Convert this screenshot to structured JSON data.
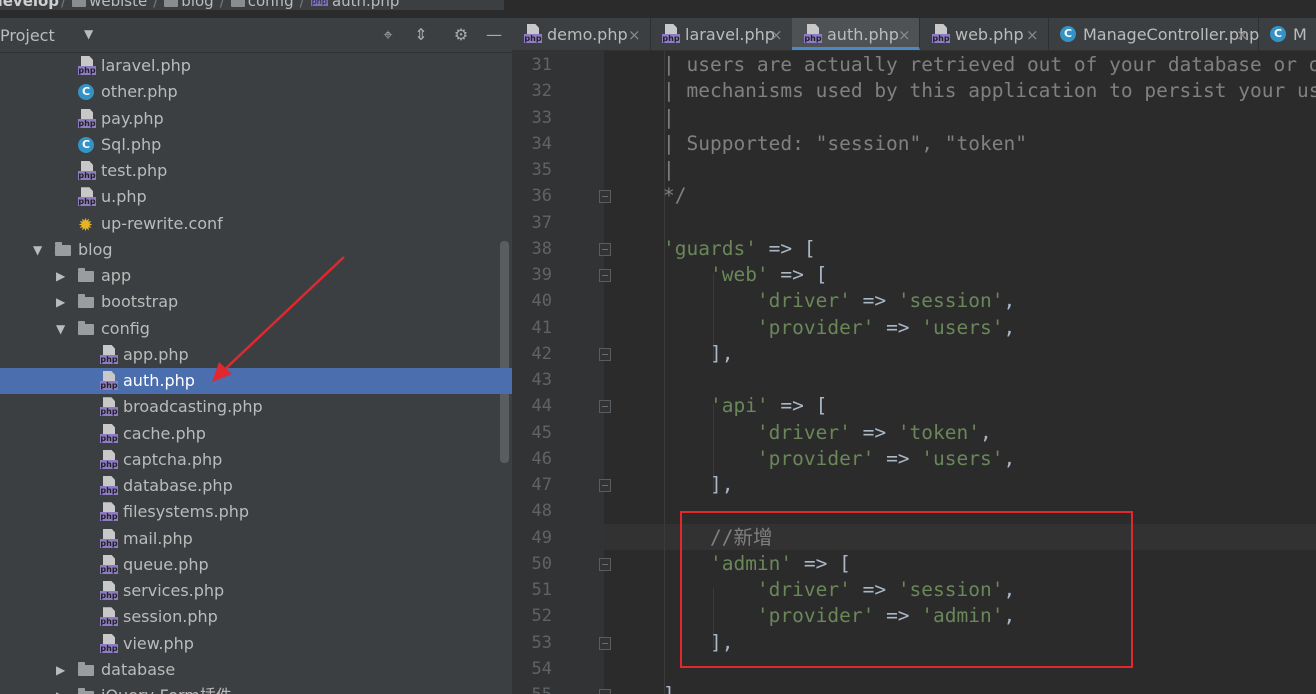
{
  "breadcrumb": {
    "segments": [
      "develop",
      "webiste",
      "blog",
      "config",
      "auth.php"
    ]
  },
  "project_panel": {
    "title": "Project",
    "tree": [
      {
        "label": "laravel.php",
        "icon": "php",
        "depth": 3
      },
      {
        "label": "other.php",
        "icon": "class",
        "depth": 3
      },
      {
        "label": "pay.php",
        "icon": "php",
        "depth": 3
      },
      {
        "label": "Sql.php",
        "icon": "class",
        "depth": 3
      },
      {
        "label": "test.php",
        "icon": "php",
        "depth": 3
      },
      {
        "label": "u.php",
        "icon": "php",
        "depth": 3
      },
      {
        "label": "up-rewrite.conf",
        "icon": "config",
        "depth": 3
      },
      {
        "label": "blog",
        "icon": "folder",
        "depth": 1,
        "expanded": true
      },
      {
        "label": "app",
        "icon": "folder",
        "depth": 2,
        "expanded": false
      },
      {
        "label": "bootstrap",
        "icon": "folder",
        "depth": 2,
        "expanded": false
      },
      {
        "label": "config",
        "icon": "folder",
        "depth": 2,
        "expanded": true
      },
      {
        "label": "app.php",
        "icon": "php",
        "depth": 4
      },
      {
        "label": "auth.php",
        "icon": "php",
        "depth": 4,
        "selected": true
      },
      {
        "label": "broadcasting.php",
        "icon": "php",
        "depth": 4
      },
      {
        "label": "cache.php",
        "icon": "php",
        "depth": 4
      },
      {
        "label": "captcha.php",
        "icon": "php",
        "depth": 4
      },
      {
        "label": "database.php",
        "icon": "php",
        "depth": 4
      },
      {
        "label": "filesystems.php",
        "icon": "php",
        "depth": 4
      },
      {
        "label": "mail.php",
        "icon": "php",
        "depth": 4
      },
      {
        "label": "queue.php",
        "icon": "php",
        "depth": 4
      },
      {
        "label": "services.php",
        "icon": "php",
        "depth": 4
      },
      {
        "label": "session.php",
        "icon": "php",
        "depth": 4
      },
      {
        "label": "view.php",
        "icon": "php",
        "depth": 4
      },
      {
        "label": "database",
        "icon": "folder",
        "depth": 2,
        "expanded": false
      },
      {
        "label": "jQuery-Form插件",
        "icon": "folder",
        "depth": 2,
        "expanded": false
      }
    ]
  },
  "tabs": [
    {
      "label": "demo.php",
      "icon": "php"
    },
    {
      "label": "laravel.php",
      "icon": "php"
    },
    {
      "label": "auth.php",
      "icon": "php",
      "active": true
    },
    {
      "label": "web.php",
      "icon": "php"
    },
    {
      "label": "ManageController.php",
      "icon": "class"
    },
    {
      "label": "M",
      "icon": "class"
    }
  ],
  "editor": {
    "lines": [
      {
        "n": "31",
        "tokens": [
          [
            "cm",
            "| users are actually retrieved out of your database or other storage"
          ]
        ]
      },
      {
        "n": "32",
        "tokens": [
          [
            "cm",
            "| mechanisms used by this application to persist your user's data."
          ]
        ]
      },
      {
        "n": "33",
        "tokens": [
          [
            "cm",
            "|"
          ]
        ]
      },
      {
        "n": "34",
        "tokens": [
          [
            "cm",
            "| Supported: \"session\", \"token\""
          ]
        ]
      },
      {
        "n": "35",
        "tokens": [
          [
            "cm",
            "|"
          ]
        ]
      },
      {
        "n": "36",
        "tokens": [
          [
            "cm",
            "*/"
          ]
        ]
      },
      {
        "n": "37",
        "tokens": []
      },
      {
        "n": "38",
        "tokens": [
          [
            "st",
            "'guards'"
          ],
          [
            "op",
            " => ["
          ]
        ]
      },
      {
        "n": "39",
        "tokens": [
          [
            "op",
            "    "
          ],
          [
            "st",
            "'web'"
          ],
          [
            "op",
            " => ["
          ]
        ]
      },
      {
        "n": "40",
        "tokens": [
          [
            "op",
            "        "
          ],
          [
            "st",
            "'driver'"
          ],
          [
            "op",
            " => "
          ],
          [
            "st",
            "'session'"
          ],
          [
            "op",
            ","
          ]
        ]
      },
      {
        "n": "41",
        "tokens": [
          [
            "op",
            "        "
          ],
          [
            "st",
            "'provider'"
          ],
          [
            "op",
            " => "
          ],
          [
            "st",
            "'users'"
          ],
          [
            "op",
            ","
          ]
        ]
      },
      {
        "n": "42",
        "tokens": [
          [
            "op",
            "    ],"
          ]
        ]
      },
      {
        "n": "43",
        "tokens": []
      },
      {
        "n": "44",
        "tokens": [
          [
            "op",
            "    "
          ],
          [
            "st",
            "'api'"
          ],
          [
            "op",
            " => ["
          ]
        ]
      },
      {
        "n": "45",
        "tokens": [
          [
            "op",
            "        "
          ],
          [
            "st",
            "'driver'"
          ],
          [
            "op",
            " => "
          ],
          [
            "st",
            "'token'"
          ],
          [
            "op",
            ","
          ]
        ]
      },
      {
        "n": "46",
        "tokens": [
          [
            "op",
            "        "
          ],
          [
            "st",
            "'provider'"
          ],
          [
            "op",
            " => "
          ],
          [
            "st",
            "'users'"
          ],
          [
            "op",
            ","
          ]
        ]
      },
      {
        "n": "47",
        "tokens": [
          [
            "op",
            "    ],"
          ]
        ]
      },
      {
        "n": "48",
        "tokens": []
      },
      {
        "n": "49",
        "tokens": [
          [
            "op",
            "    "
          ],
          [
            "cm",
            "//新增"
          ]
        ]
      },
      {
        "n": "50",
        "tokens": [
          [
            "op",
            "    "
          ],
          [
            "st",
            "'admin'"
          ],
          [
            "op",
            " => ["
          ]
        ]
      },
      {
        "n": "51",
        "tokens": [
          [
            "op",
            "        "
          ],
          [
            "st",
            "'driver'"
          ],
          [
            "op",
            " => "
          ],
          [
            "st",
            "'session'"
          ],
          [
            "op",
            ","
          ]
        ]
      },
      {
        "n": "52",
        "tokens": [
          [
            "op",
            "        "
          ],
          [
            "st",
            "'provider'"
          ],
          [
            "op",
            " => "
          ],
          [
            "st",
            "'admin'"
          ],
          [
            "op",
            ","
          ]
        ]
      },
      {
        "n": "53",
        "tokens": [
          [
            "op",
            "    ],"
          ]
        ]
      },
      {
        "n": "54",
        "tokens": []
      },
      {
        "n": "55",
        "tokens": [
          [
            "op",
            "],"
          ]
        ]
      }
    ]
  },
  "colors": {
    "panel_bg": "#3c3f41",
    "editor_bg": "#2b2b2b",
    "selection": "#4b6eaf",
    "string": "#6a8759",
    "comment": "#808080",
    "annotation_red": "#e0282e"
  }
}
